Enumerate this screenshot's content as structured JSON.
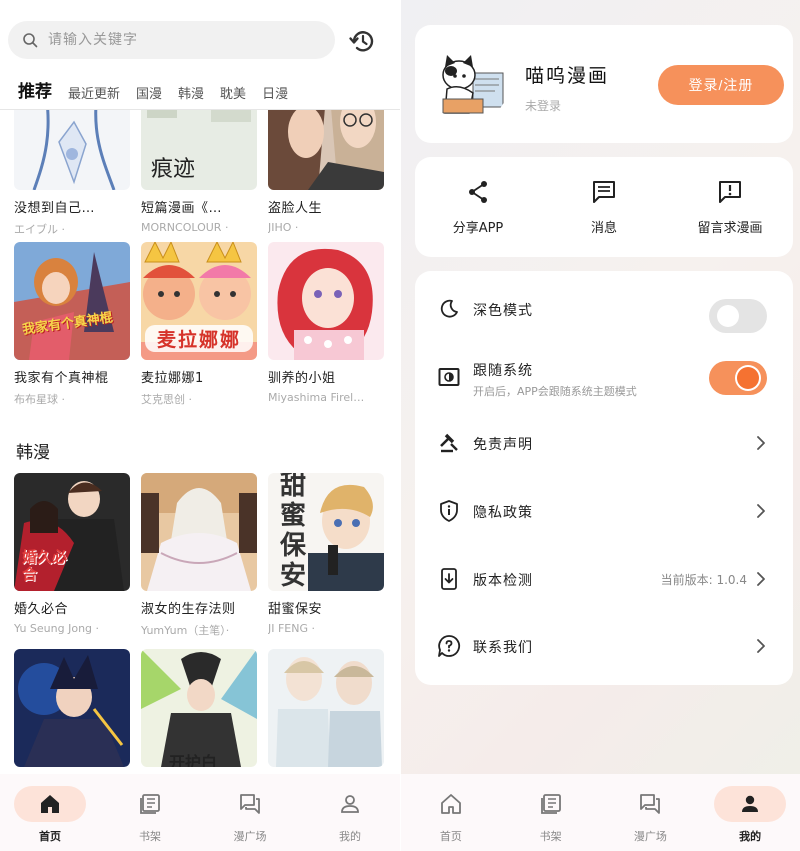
{
  "left": {
    "search": {
      "placeholder": "请输入关键字"
    },
    "tabs": [
      {
        "label": "推荐",
        "active": true
      },
      {
        "label": "最近更新"
      },
      {
        "label": "国漫"
      },
      {
        "label": "韩漫"
      },
      {
        "label": "耽美"
      },
      {
        "label": "日漫"
      }
    ],
    "row1": [
      {
        "title": "没想到自己…",
        "author": "エイブル ·"
      },
      {
        "title": "短篇漫画《…",
        "author": "MORNCOLOUR ·"
      },
      {
        "title": "盗脸人生",
        "author": "JIHO ·"
      }
    ],
    "row2": [
      {
        "title": "我家有个真神棍",
        "author": "布布星球 ·",
        "cover_text": "我家有个真神棍"
      },
      {
        "title": "麦拉娜娜1",
        "author": "艾克思创 ·",
        "cover_text": "麦拉娜娜"
      },
      {
        "title": "驯养的小姐",
        "author": "Miyashima Firel…"
      }
    ],
    "section_korean": "韩漫",
    "row3": [
      {
        "title": "婚久必合",
        "author": "Yu Seung Jong ·",
        "cover_text": "婚久必合"
      },
      {
        "title": "淑女的生存法则",
        "author": "YumYum（主笔）·"
      },
      {
        "title": "甜蜜保安",
        "author": "JI FENG ·",
        "cover_text": "甜蜜保安"
      }
    ],
    "row4": [
      {
        "title": "",
        "author": ""
      },
      {
        "title": "",
        "author": "",
        "cover_text": "开护白"
      },
      {
        "title": "",
        "author": ""
      }
    ]
  },
  "right": {
    "profile": {
      "app_name": "喵呜漫画",
      "status": "未登录",
      "login_label": "登录/注册"
    },
    "actions": [
      {
        "label": "分享APP",
        "icon": "share-icon"
      },
      {
        "label": "消息",
        "icon": "message-icon"
      },
      {
        "label": "留言求漫画",
        "icon": "feedback-icon"
      }
    ],
    "settings": {
      "dark_mode": {
        "label": "深色模式",
        "enabled": false
      },
      "follow_system": {
        "label": "跟随系统",
        "sub": "开启后，APP会跟随系统主题模式",
        "enabled": true
      },
      "disclaimer": {
        "label": "免责声明"
      },
      "privacy": {
        "label": "隐私政策"
      },
      "version": {
        "label": "版本检测",
        "value": "当前版本: 1.0.4"
      },
      "contact": {
        "label": "联系我们"
      }
    }
  },
  "nav": {
    "items": [
      "首页",
      "书架",
      "漫广场",
      "我的"
    ],
    "left_active": "首页",
    "right_active": "我的"
  },
  "colors": {
    "accent": "#f6915b",
    "accent_dark": "#f57231",
    "active_pill": "#fde3d9"
  }
}
